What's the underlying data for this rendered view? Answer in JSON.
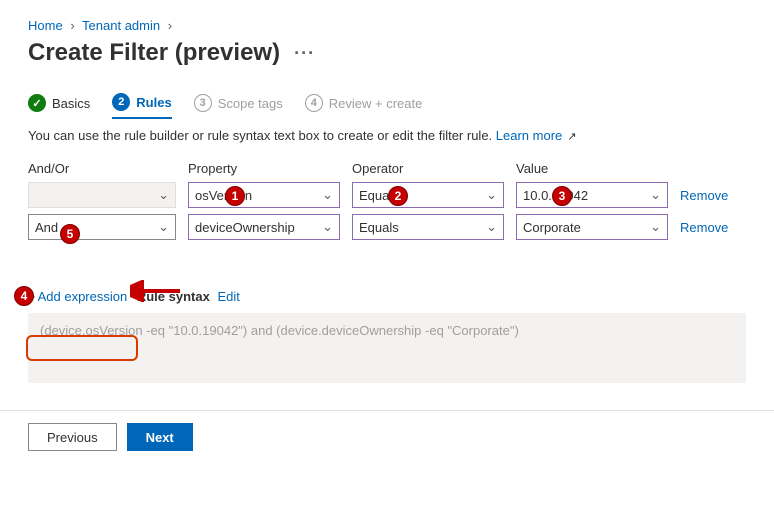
{
  "breadcrumb": {
    "home": "Home",
    "tenant": "Tenant admin"
  },
  "title": "Create Filter (preview)",
  "steps": {
    "s1": {
      "label": "Basics"
    },
    "s2": {
      "num": "2",
      "label": "Rules"
    },
    "s3": {
      "num": "3",
      "label": "Scope tags"
    },
    "s4": {
      "num": "4",
      "label": "Review + create"
    }
  },
  "intro": {
    "text": "You can use the rule builder or rule syntax text box to create or edit the filter rule. ",
    "link": "Learn more"
  },
  "cols": {
    "andor": "And/Or",
    "property": "Property",
    "operator": "Operator",
    "value": "Value"
  },
  "rows": [
    {
      "andor": "",
      "property": "osVersion",
      "operator": "Equals",
      "value": "10.0.19042",
      "remove": "Remove"
    },
    {
      "andor": "And",
      "property": "deviceOwnership",
      "operator": "Equals",
      "value": "Corporate",
      "remove": "Remove"
    }
  ],
  "addexpr": "Add expression",
  "syntax": {
    "label": "Rule syntax",
    "edit": "Edit",
    "text": "(device.osVersion -eq \"10.0.19042\") and (device.deviceOwnership -eq \"Corporate\")"
  },
  "footer": {
    "prev": "Previous",
    "next": "Next"
  },
  "annotations": {
    "a1": "1",
    "a2": "2",
    "a3": "3",
    "a4": "4",
    "a5": "5"
  }
}
